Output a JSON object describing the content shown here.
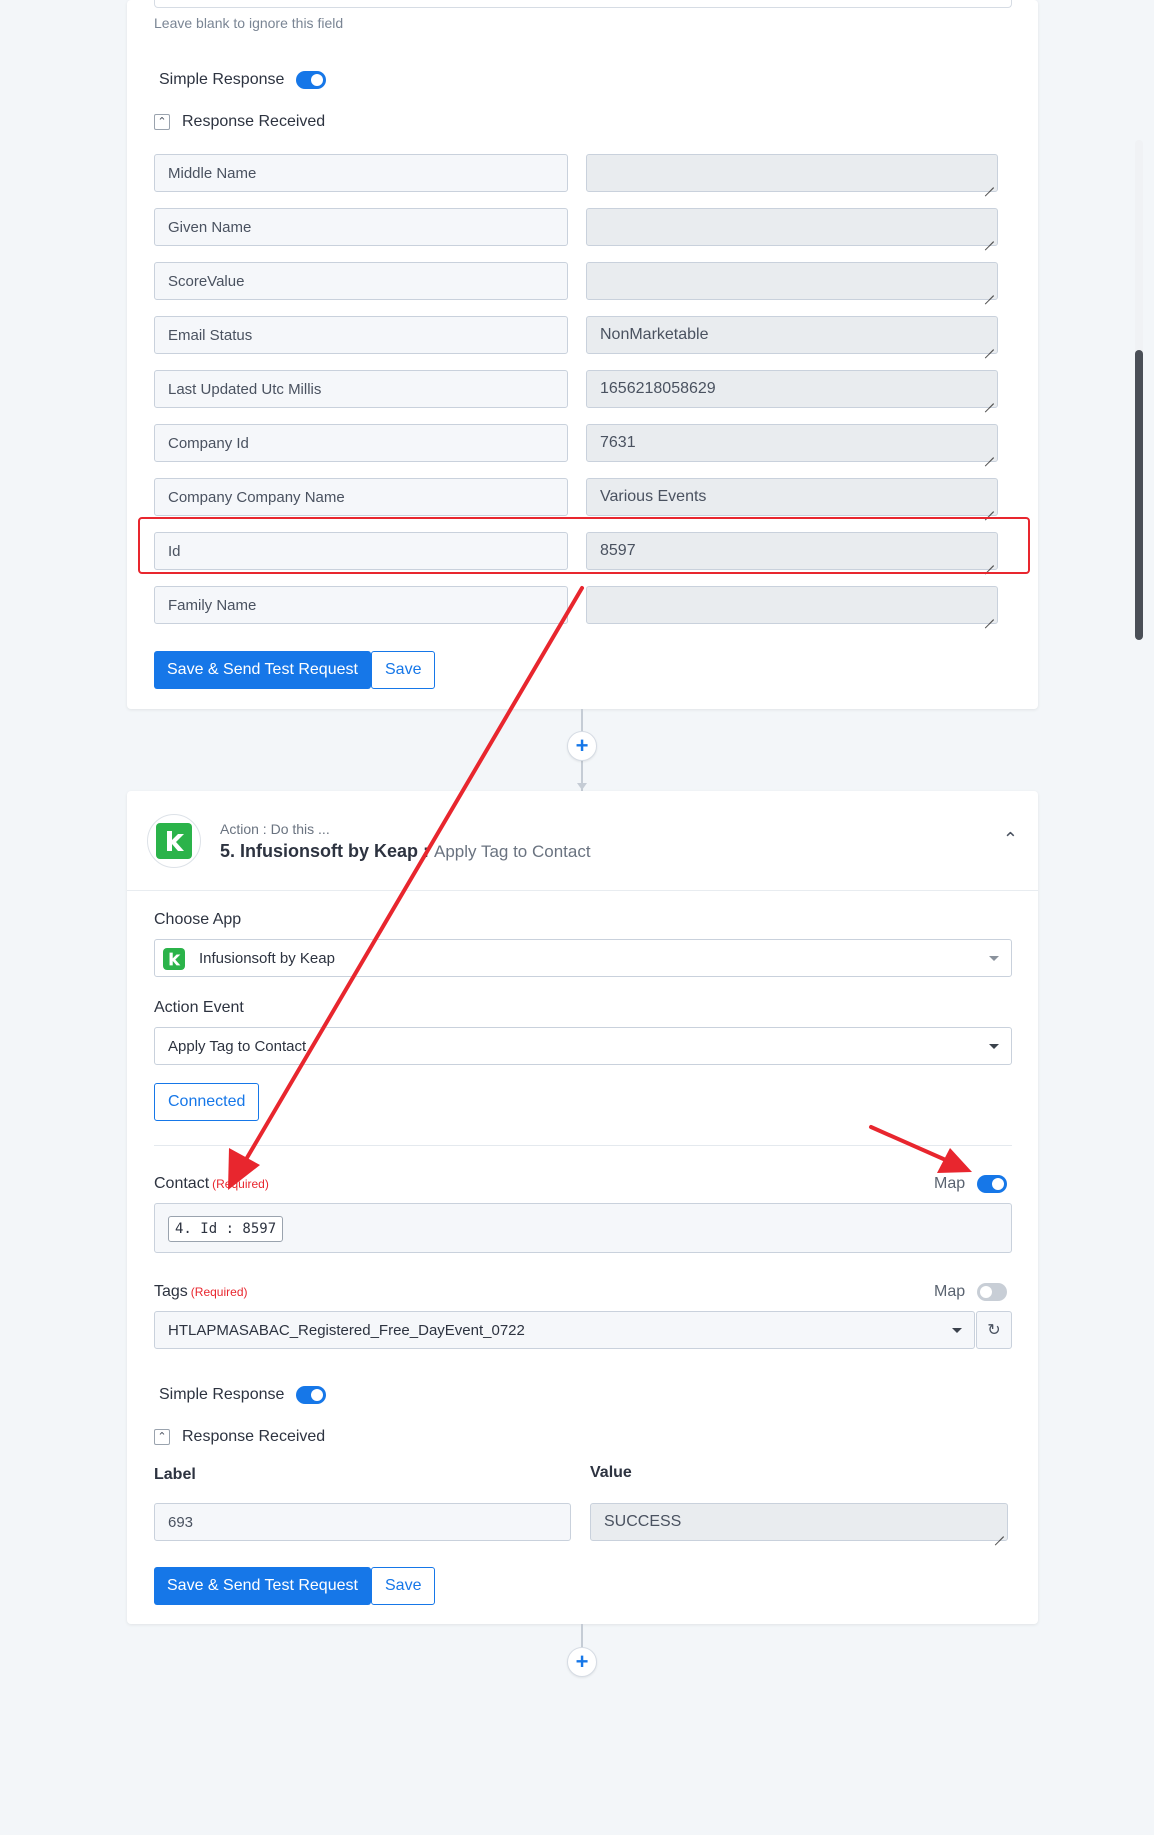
{
  "card1": {
    "hint": "Leave blank to ignore this field",
    "simple_response_label": "Simple Response",
    "response_received_label": "Response Received",
    "rows": [
      {
        "label": "Middle Name",
        "value": ""
      },
      {
        "label": "Given Name",
        "value": ""
      },
      {
        "label": "ScoreValue",
        "value": ""
      },
      {
        "label": "Email Status",
        "value": "NonMarketable"
      },
      {
        "label": "Last Updated Utc Millis",
        "value": "1656218058629"
      },
      {
        "label": "Company Id",
        "value": "7631"
      },
      {
        "label": "Company Company Name",
        "value": "Various Events"
      },
      {
        "label": "Id",
        "value": "8597"
      },
      {
        "label": "Family Name",
        "value": ""
      }
    ],
    "save_send_label": "Save & Send Test Request",
    "save_label": "Save"
  },
  "card2": {
    "action_sub": "Action : Do this ...",
    "action_title": "5. Infusionsoft by Keap : ",
    "action_event": "Apply Tag to Contact",
    "choose_app_label": "Choose App",
    "app_value": "Infusionsoft by Keap",
    "action_event_label": "Action Event",
    "action_event_value": "Apply Tag to Contact",
    "connected_label": "Connected",
    "contact_label": "Contact",
    "required": "(Required)",
    "map_label": "Map",
    "contact_chip": "4. Id : 8597",
    "tags_label": "Tags",
    "tags_value": "HTLAPMASABAC_Registered_Free_DayEvent_0722",
    "simple_response_label": "Simple Response",
    "response_received_label": "Response Received",
    "label_header": "Label",
    "value_header": "Value",
    "result_label": "693",
    "result_value": "SUCCESS",
    "save_send_label": "Save & Send Test Request",
    "save_label": "Save"
  },
  "colors": {
    "accent": "#1677e8",
    "annotation": "#e8262e",
    "keap_green": "#2bb34a"
  }
}
